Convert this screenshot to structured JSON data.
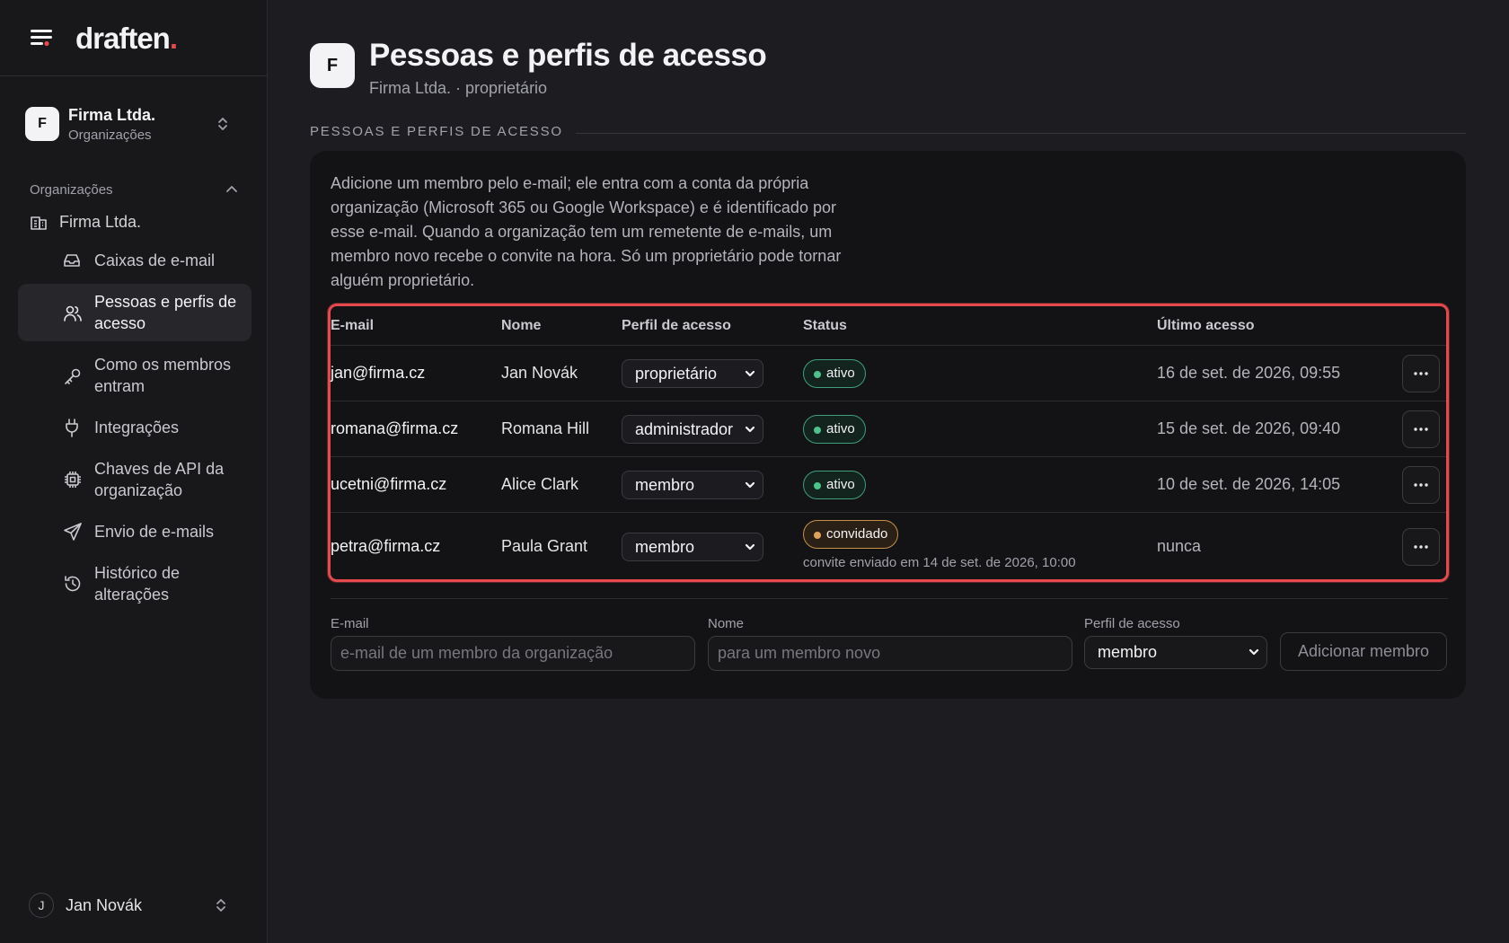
{
  "brand": {
    "name": "draften",
    "dot": "."
  },
  "org_switch": {
    "initial": "F",
    "name": "Firma Ltda.",
    "sub": "Organizações"
  },
  "sidebar": {
    "group_label": "Organizações",
    "org_item": "Firma Ltda.",
    "items": [
      {
        "label": "Caixas de e-mail",
        "icon": "inbox-icon"
      },
      {
        "label": "Pessoas e perfis de acesso",
        "icon": "users-icon",
        "active": true
      },
      {
        "label": "Como os membros entram",
        "icon": "key-icon"
      },
      {
        "label": "Integrações",
        "icon": "plug-icon"
      },
      {
        "label": "Chaves de API da organização",
        "icon": "chip-icon"
      },
      {
        "label": "Envio de e-mails",
        "icon": "send-icon"
      },
      {
        "label": "Histórico de alterações",
        "icon": "history-icon"
      }
    ]
  },
  "user": {
    "initial": "J",
    "name": "Jan Novák"
  },
  "page": {
    "initial": "F",
    "title": "Pessoas e perfis de acesso",
    "subtitle": "Firma Ltda. · proprietário",
    "section_title": "PESSOAS E PERFIS DE ACESSO",
    "intro": "Adicione um membro pelo e-mail; ele entra com a conta da própria organização (Microsoft 365 ou Google Workspace) e é identificado por esse e-mail. Quando a organização tem um remetente de e-mails, um membro novo recebe o convite na hora. Só um proprietário pode tornar alguém proprietário."
  },
  "table": {
    "headers": {
      "email": "E-mail",
      "name": "Nome",
      "role": "Perfil de acesso",
      "status": "Status",
      "last": "Último acesso"
    },
    "rows": [
      {
        "email": "jan@firma.cz",
        "name": "Jan Novák",
        "role": "proprietário",
        "status": "ativo",
        "last": "16 de set. de 2026, 09:55"
      },
      {
        "email": "romana@firma.cz",
        "name": "Romana Hill",
        "role": "administrador",
        "status": "ativo",
        "last": "15 de set. de 2026, 09:40"
      },
      {
        "email": "ucetni@firma.cz",
        "name": "Alice Clark",
        "role": "membro",
        "status": "ativo",
        "last": "10 de set. de 2026, 14:05"
      },
      {
        "email": "petra@firma.cz",
        "name": "Paula Grant",
        "role": "membro",
        "status": "convidado",
        "note": "convite enviado em 14 de set. de 2026, 10:00",
        "last": "nunca"
      }
    ]
  },
  "add_form": {
    "email_label": "E-mail",
    "email_placeholder": "e-mail de um membro da organização",
    "name_label": "Nome",
    "name_placeholder": "para um membro novo",
    "role_label": "Perfil de acesso",
    "role_value": "membro",
    "submit": "Adicionar membro"
  },
  "colors": {
    "background": "#1d1d21",
    "sidebar": "#18181b",
    "card": "#131316",
    "highlight": "#e5484d",
    "status_active": "#4cc38a",
    "status_invited": "#e0a35c"
  }
}
